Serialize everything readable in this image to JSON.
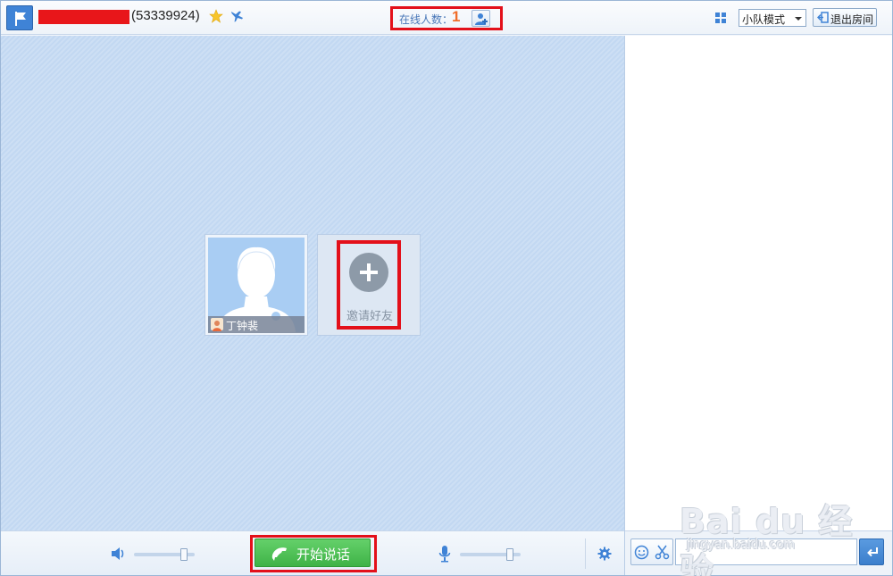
{
  "header": {
    "room_id": "(53339924)",
    "online_label": "在线人数：",
    "online_count": "1",
    "mode_selected": "小队模式",
    "exit_label": "退出房间"
  },
  "stage": {
    "members": [
      {
        "name": "丁钟裴"
      }
    ],
    "invite_label": "邀请好友"
  },
  "controls": {
    "talk_label": "开始说话",
    "speaker_volume": 0.9,
    "mic_volume": 0.9
  },
  "watermark": {
    "main": "Bai du 经验",
    "sub": "jingyan.baidu.com"
  },
  "colors": {
    "accent": "#3f83d6",
    "highlight": "#e3101a",
    "talk_green": "#4cbf53",
    "online_count": "#f06d2a"
  },
  "icons": {
    "room": "flag-icon",
    "favorite": "star-icon",
    "share": "plane-icon",
    "add_member": "add-user-icon",
    "layout": "grid-icon",
    "exit": "exit-icon",
    "speaker": "speaker-icon",
    "talk": "phone-icon",
    "mic": "microphone-icon",
    "settings": "gear-icon",
    "emoji": "smile-icon",
    "screenshot": "scissors-icon",
    "send": "enter-icon"
  }
}
